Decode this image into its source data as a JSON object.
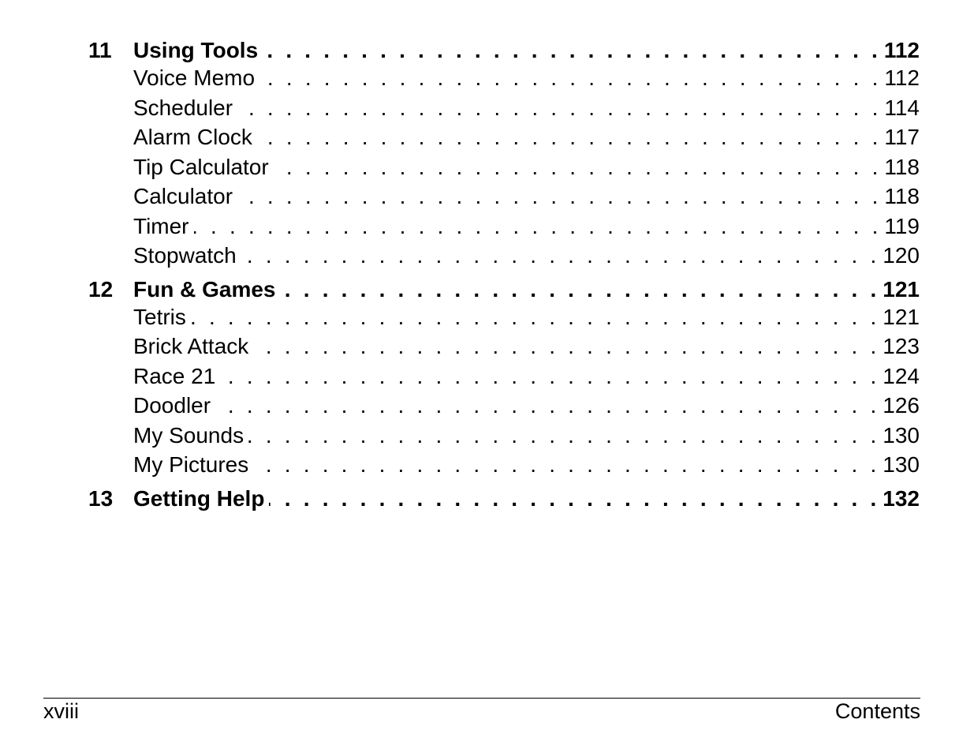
{
  "toc": {
    "chapters": [
      {
        "number": "11",
        "title": "Using Tools",
        "page": "112",
        "sections": [
          {
            "title": "Voice Memo",
            "page": "112"
          },
          {
            "title": "Scheduler",
            "page": "114"
          },
          {
            "title": "Alarm Clock",
            "page": "117"
          },
          {
            "title": "Tip Calculator",
            "page": "118"
          },
          {
            "title": "Calculator",
            "page": "118"
          },
          {
            "title": "Timer",
            "page": "119"
          },
          {
            "title": "Stopwatch",
            "page": "120"
          }
        ]
      },
      {
        "number": "12",
        "title": "Fun & Games",
        "page": "121",
        "sections": [
          {
            "title": "Tetris",
            "page": "121"
          },
          {
            "title": "Brick Attack",
            "page": "123"
          },
          {
            "title": "Race 21",
            "page": "124"
          },
          {
            "title": "Doodler",
            "page": "126"
          },
          {
            "title": "My Sounds",
            "page": "130"
          },
          {
            "title": "My Pictures",
            "page": "130"
          }
        ]
      },
      {
        "number": "13",
        "title": "Getting Help",
        "page": "132",
        "sections": []
      }
    ]
  },
  "footer": {
    "page_number": "xviii",
    "section_name": "Contents"
  }
}
